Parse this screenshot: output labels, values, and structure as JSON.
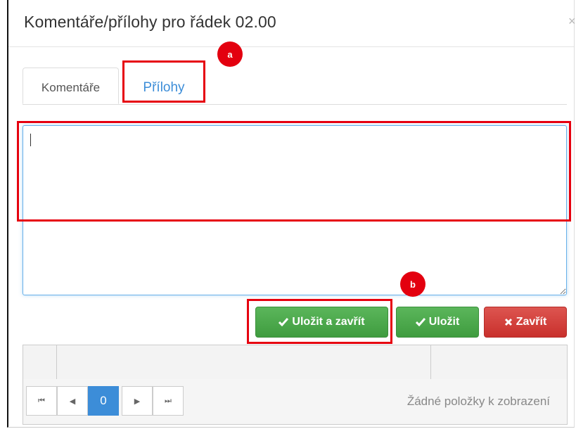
{
  "dialog": {
    "title": "Komentáře/přílohy pro řádek 02.00",
    "close_glyph": "×"
  },
  "tabs": [
    {
      "label": "Komentáře",
      "active": true
    },
    {
      "label": "Přílohy",
      "active": false
    }
  ],
  "comment": {
    "value": ""
  },
  "buttons": {
    "save_close": "Uložit a zavřít",
    "save": "Uložit",
    "close": "Zavřít"
  },
  "pager": {
    "first_glyph": "⏮",
    "prev_glyph": "◀",
    "page": "0",
    "next_glyph": "▶",
    "last_glyph": "⏭",
    "info": "Žádné položky k zobrazení"
  },
  "annotations": {
    "a": "a",
    "b": "b"
  },
  "colors": {
    "accent_blue": "#3c8dd8",
    "success_green": "#449d44",
    "danger_red": "#d9534f",
    "annotation_red": "#e3000f"
  },
  "icons": {
    "save_close": "check-icon",
    "save": "check-icon",
    "close": "times-icon"
  }
}
